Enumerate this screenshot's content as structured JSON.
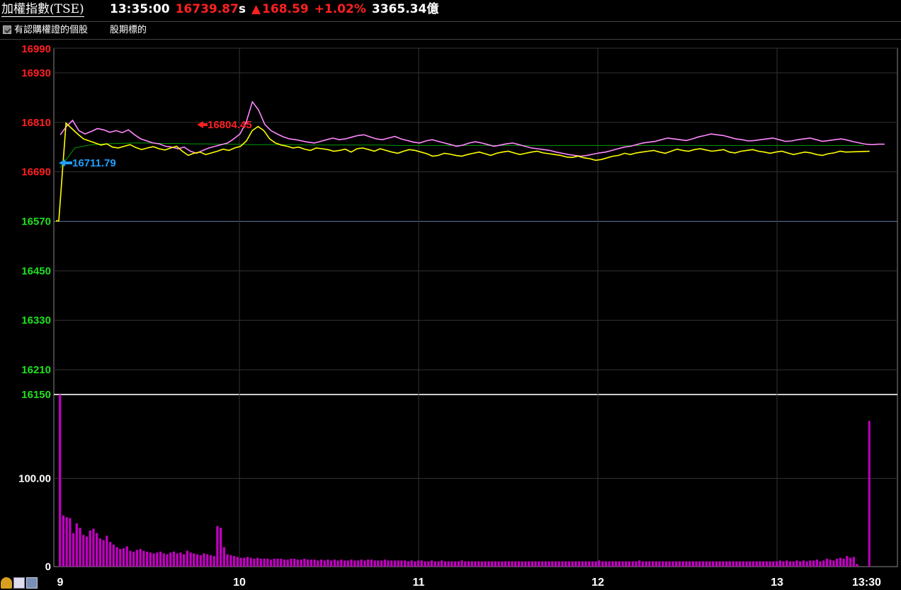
{
  "header": {
    "title": "加權指數(TSE)",
    "time": "13:35:00",
    "price": "16739.87",
    "price_suffix": "s",
    "arrow": "▲",
    "change": "168.59",
    "change_pct": "+1.02%",
    "volume": "3365.34億"
  },
  "options": {
    "checkbox_label": "有認購權證的個股",
    "link_label": "股期標的"
  },
  "colors": {
    "up": "#ff2020",
    "down": "#20e020",
    "index_line": "#ffff00",
    "weighted_line": "#ff88ff",
    "avg_line": "#00a000",
    "volume_bar": "#c000c0",
    "low_arrow": "#20a0ff"
  },
  "icons": [
    "bell-icon",
    "chart-tool-icon",
    "page-icon"
  ],
  "chart_data": [
    {
      "type": "line",
      "y_ticks": [
        {
          "value": 16990,
          "label": "16990",
          "color": "up"
        },
        {
          "value": 16930,
          "label": "16930",
          "color": "up"
        },
        {
          "value": 16810,
          "label": "16810",
          "color": "up"
        },
        {
          "value": 16690,
          "label": "16690",
          "color": "up"
        },
        {
          "value": 16570,
          "label": "16570",
          "color": "down"
        },
        {
          "value": 16450,
          "label": "16450",
          "color": "down"
        },
        {
          "value": 16330,
          "label": "16330",
          "color": "down"
        },
        {
          "value": 16210,
          "label": "16210",
          "color": "down"
        },
        {
          "value": 16150,
          "label": "16150",
          "color": "down"
        }
      ],
      "ylim": [
        16150,
        16990
      ],
      "reference": 16571.28,
      "x_ticks": [
        "9",
        "10",
        "11",
        "12",
        "13",
        "13:30"
      ],
      "high": {
        "value": 16804.45,
        "label": "16804.45"
      },
      "low": {
        "value": 16711.79,
        "label": "16711.79"
      },
      "series": [
        {
          "color": "index_line",
          "values": [
            16571,
            16808,
            16795,
            16782,
            16770,
            16765,
            16760,
            16755,
            16758,
            16750,
            16748,
            16752,
            16756,
            16749,
            16744,
            16748,
            16751,
            16746,
            16743,
            16748,
            16752,
            16740,
            16730,
            16735,
            16738,
            16732,
            16736,
            16740,
            16745,
            16742,
            16748,
            16752,
            16765,
            16790,
            16800,
            16790,
            16770,
            16760,
            16755,
            16752,
            16748,
            16750,
            16745,
            16742,
            16748,
            16746,
            16744,
            16740,
            16742,
            16745,
            16738,
            16746,
            16748,
            16744,
            16740,
            16746,
            16742,
            16738,
            16735,
            16740,
            16744,
            16742,
            16738,
            16734,
            16728,
            16730,
            16735,
            16733,
            16730,
            16728,
            16732,
            16735,
            16738,
            16734,
            16730,
            16735,
            16738,
            16740,
            16736,
            16732,
            16735,
            16738,
            16740,
            16736,
            16734,
            16732,
            16730,
            16726,
            16725,
            16728,
            16724,
            16722,
            16718,
            16720,
            16724,
            16728,
            16730,
            16735,
            16732,
            16736,
            16738,
            16740,
            16742,
            16738,
            16735,
            16740,
            16745,
            16742,
            16740,
            16744,
            16746,
            16743,
            16740,
            16742,
            16744,
            16738,
            16736,
            16740,
            16742,
            16744,
            16740,
            16738,
            16735,
            16738,
            16740,
            16736,
            16732,
            16735,
            16738,
            16736,
            16732,
            16730,
            16734,
            16736,
            16740,
            16738
          ],
          "end": 16739.87
        },
        {
          "color": "weighted_line",
          "values": [
            16780,
            16800,
            16815,
            16790,
            16782,
            16788,
            16795,
            16792,
            16786,
            16790,
            16785,
            16792,
            16780,
            16770,
            16765,
            16760,
            16758,
            16752,
            16750,
            16746,
            16750,
            16740,
            16735,
            16742,
            16748,
            16752,
            16756,
            16760,
            16770,
            16782,
            16810,
            16860,
            16840,
            16805,
            16790,
            16782,
            16775,
            16770,
            16768,
            16765,
            16762,
            16760,
            16764,
            16768,
            16772,
            16768,
            16770,
            16774,
            16778,
            16780,
            16775,
            16770,
            16768,
            16772,
            16776,
            16770,
            16766,
            16762,
            16760,
            16765,
            16768,
            16764,
            16760,
            16756,
            16752,
            16755,
            16760,
            16763,
            16760,
            16756,
            16752,
            16755,
            16758,
            16760,
            16756,
            16752,
            16748,
            16746,
            16744,
            16742,
            16738,
            16735,
            16732,
            16730,
            16728,
            16730,
            16733,
            16736,
            16738,
            16742,
            16746,
            16750,
            16752,
            16756,
            16760,
            16762,
            16764,
            16768,
            16772,
            16770,
            16768,
            16766,
            16770,
            16775,
            16778,
            16782,
            16780,
            16778,
            16774,
            16770,
            16768,
            16765,
            16766,
            16768,
            16770,
            16772,
            16768,
            16764,
            16765,
            16768,
            16770,
            16772,
            16768,
            16764,
            16766,
            16768,
            16770,
            16767,
            16763,
            16760,
            16757,
            16756,
            16757,
            16757
          ]
        },
        {
          "color": "avg_line",
          "values": [
            16700,
            16748,
            16755,
            16758,
            16759,
            16760,
            16760,
            16759,
            16759,
            16758,
            16758,
            16757,
            16757,
            16756,
            16756,
            16756,
            16756,
            16755,
            16755,
            16755,
            16755,
            16755,
            16755,
            16754,
            16754,
            16754,
            16754,
            16754,
            16754,
            16754,
            16754,
            16754,
            16754,
            16754,
            16754,
            16754,
            16754,
            16754,
            16754,
            16754,
            16754,
            16754,
            16754,
            16754,
            16754,
            16754,
            16754,
            16754,
            16754,
            16754,
            16754,
            16754,
            16754,
            16754,
            16754,
            16754
          ]
        }
      ]
    },
    {
      "type": "bar",
      "y_ticks": [
        {
          "value": 100,
          "label": "100.00"
        },
        {
          "value": 0,
          "label": "0"
        }
      ],
      "ylim": [
        0,
        195
      ],
      "values": [
        195,
        58,
        56,
        55,
        38,
        49,
        44,
        36,
        34,
        41,
        43,
        38,
        32,
        30,
        35,
        28,
        25,
        22,
        20,
        21,
        23,
        18,
        17,
        19,
        20,
        18,
        17,
        16,
        15,
        16,
        17,
        15,
        14,
        16,
        17,
        15,
        16,
        14,
        18,
        16,
        15,
        14,
        13,
        15,
        14,
        13,
        12,
        46,
        44,
        22,
        14,
        13,
        12,
        11,
        10,
        10,
        11,
        10,
        9,
        10,
        9,
        9,
        9,
        8,
        9,
        9,
        9,
        8,
        8,
        9,
        9,
        8,
        8,
        9,
        8,
        8,
        8,
        7,
        8,
        7,
        8,
        7,
        8,
        7,
        8,
        7,
        7,
        8,
        7,
        7,
        8,
        7,
        8,
        8,
        7,
        7,
        7,
        8,
        7,
        7,
        7,
        7,
        7,
        7,
        6,
        7,
        6,
        7,
        7,
        6,
        6,
        7,
        6,
        6,
        7,
        6,
        6,
        6,
        6,
        6,
        7,
        6,
        6,
        6,
        6,
        6,
        6,
        6,
        6,
        6,
        6,
        6,
        6,
        6,
        6,
        6,
        6,
        6,
        6,
        6,
        6,
        6,
        6,
        6,
        6,
        6,
        6,
        6,
        6,
        6,
        6,
        6,
        6,
        6,
        6,
        6,
        6,
        6,
        6,
        6,
        6,
        7,
        6,
        6,
        6,
        6,
        6,
        6,
        6,
        6,
        6,
        6,
        6,
        7,
        6,
        6,
        6,
        6,
        6,
        6,
        6,
        6,
        6,
        6,
        6,
        6,
        6,
        6,
        6,
        6,
        6,
        6,
        6,
        6,
        6,
        6,
        6,
        6,
        6,
        6,
        6,
        6,
        6,
        6,
        6,
        6,
        6,
        6,
        6,
        6,
        6,
        6,
        6,
        6,
        6,
        7,
        6,
        7,
        6,
        6,
        7,
        6,
        7,
        6,
        7,
        7,
        8,
        6,
        7,
        9,
        8,
        7,
        9,
        10,
        9,
        12,
        10,
        11,
        3
      ],
      "final_bar": 165
    }
  ]
}
